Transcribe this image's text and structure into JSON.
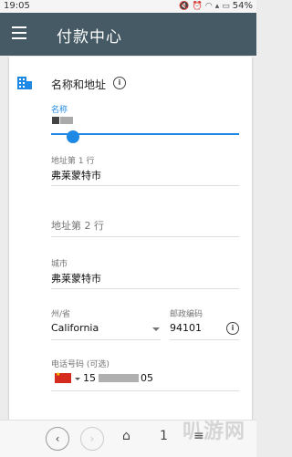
{
  "status_bar": {
    "time": "19:05",
    "battery": "54%"
  },
  "app_bar": {
    "title": "付款中心"
  },
  "section": {
    "title": "名称和地址"
  },
  "fields": {
    "name": {
      "label": "名称"
    },
    "address1": {
      "label": "地址第 1 行",
      "value": "弗莱蒙特市"
    },
    "address2": {
      "placeholder": "地址第 2 行"
    },
    "city": {
      "label": "城市",
      "value": "弗莱蒙特市"
    },
    "state": {
      "label": "州/省",
      "value": "California"
    },
    "zip": {
      "label": "邮政编码",
      "value": "94101"
    },
    "phone": {
      "label": "电话号码 (可选)",
      "value_prefix": "15",
      "value_suffix": "05"
    }
  },
  "nav": {
    "page_count": "1"
  },
  "watermark": "叭游网",
  "colors": {
    "app_bar": "#455a64",
    "accent": "#1e88e5"
  }
}
